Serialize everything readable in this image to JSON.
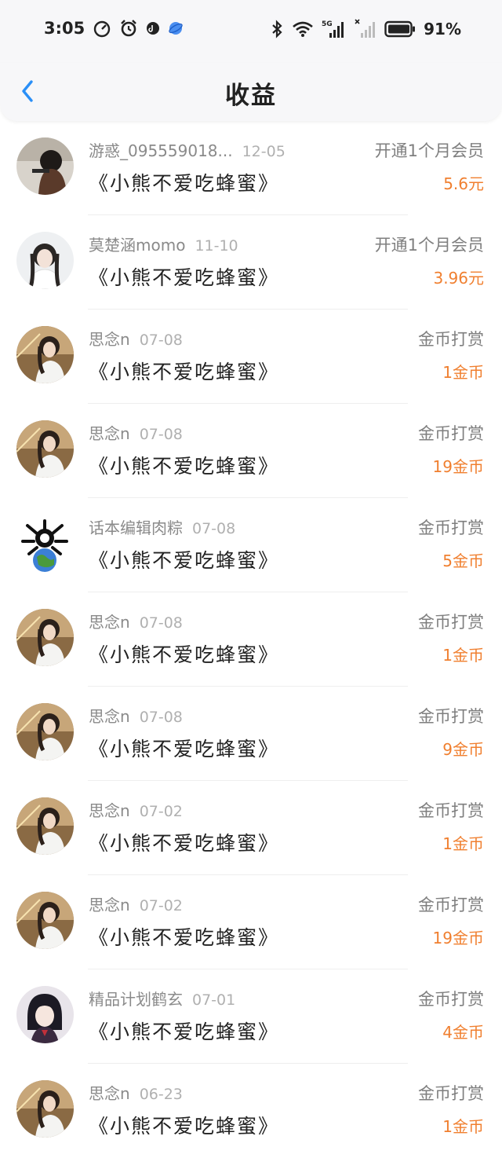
{
  "status_bar": {
    "time": "3:05",
    "battery": "91%",
    "network": "5G"
  },
  "header": {
    "title": "收益",
    "back_icon": "chevron-left-icon"
  },
  "colors": {
    "amount": "#f07f2f",
    "back": "#2a8ff7"
  },
  "items": [
    {
      "name": "游惑_095559018...",
      "date": "12-05",
      "book": "《小熊不爱吃蜂蜜》",
      "type": "开通1个月会员",
      "amount": "5.6元",
      "avatar": "photo-girl-dark"
    },
    {
      "name": "莫楚涵momo",
      "date": "11-10",
      "book": "《小熊不爱吃蜂蜜》",
      "type": "开通1个月会员",
      "amount": "3.96元",
      "avatar": "photo-girl-light"
    },
    {
      "name": "思念n",
      "date": "07-08",
      "book": "《小熊不爱吃蜂蜜》",
      "type": "金币打赏",
      "amount": "1金币",
      "avatar": "photo-girl-sunset"
    },
    {
      "name": "思念n",
      "date": "07-08",
      "book": "《小熊不爱吃蜂蜜》",
      "type": "金币打赏",
      "amount": "19金币",
      "avatar": "photo-girl-sunset"
    },
    {
      "name": "话本编辑肉粽",
      "date": "07-08",
      "book": "《小熊不爱吃蜂蜜》",
      "type": "金币打赏",
      "amount": "5金币",
      "avatar": "cartoon-earth"
    },
    {
      "name": "思念n",
      "date": "07-08",
      "book": "《小熊不爱吃蜂蜜》",
      "type": "金币打赏",
      "amount": "1金币",
      "avatar": "photo-girl-sunset"
    },
    {
      "name": "思念n",
      "date": "07-08",
      "book": "《小熊不爱吃蜂蜜》",
      "type": "金币打赏",
      "amount": "9金币",
      "avatar": "photo-girl-sunset"
    },
    {
      "name": "思念n",
      "date": "07-02",
      "book": "《小熊不爱吃蜂蜜》",
      "type": "金币打赏",
      "amount": "1金币",
      "avatar": "photo-girl-sunset"
    },
    {
      "name": "思念n",
      "date": "07-02",
      "book": "《小熊不爱吃蜂蜜》",
      "type": "金币打赏",
      "amount": "19金币",
      "avatar": "photo-girl-sunset"
    },
    {
      "name": "精品计划鹤玄",
      "date": "07-01",
      "book": "《小熊不爱吃蜂蜜》",
      "type": "金币打赏",
      "amount": "4金币",
      "avatar": "anime-character"
    },
    {
      "name": "思念n",
      "date": "06-23",
      "book": "《小熊不爱吃蜂蜜》",
      "type": "金币打赏",
      "amount": "1金币",
      "avatar": "photo-girl-sunset"
    }
  ]
}
